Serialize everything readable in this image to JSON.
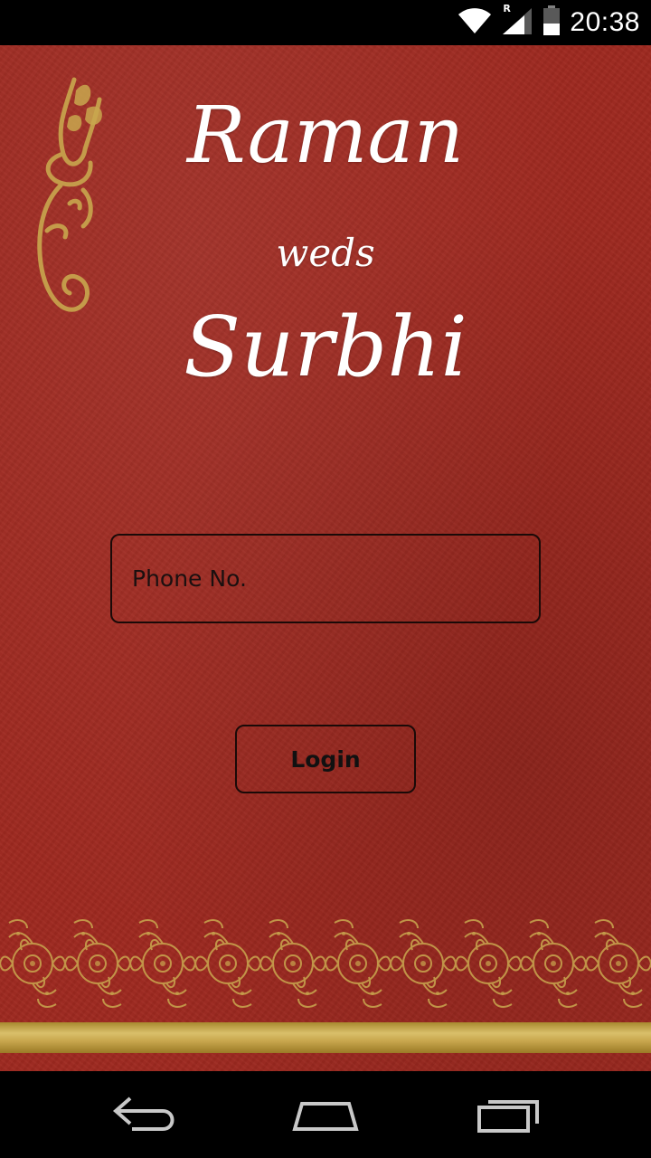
{
  "status_bar": {
    "time": "20:38",
    "icons": [
      "wifi-icon",
      "cellular-signal-icon",
      "battery-icon"
    ],
    "roaming_indicator": "R"
  },
  "invitation": {
    "groom": "Raman",
    "connector": "weds",
    "bride": "Surbhi"
  },
  "login_form": {
    "phone_placeholder": "Phone No.",
    "phone_value": "",
    "login_label": "Login"
  },
  "colors": {
    "background_red": "#9e2920",
    "gold": "#c9a74e",
    "title_text": "#ffffff"
  },
  "nav_bar": {
    "icons": [
      "back-icon",
      "home-icon",
      "recent-apps-icon"
    ]
  }
}
